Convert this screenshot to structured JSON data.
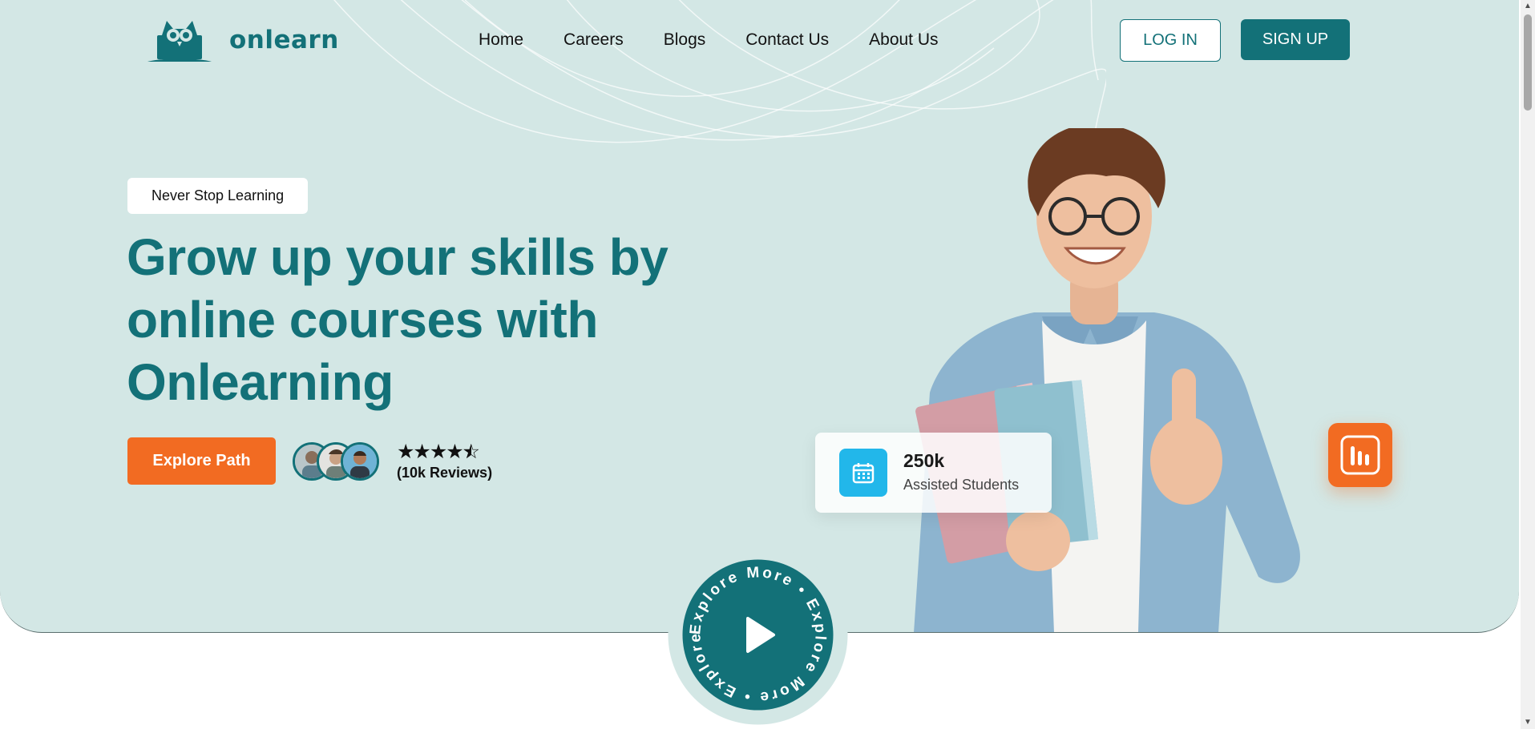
{
  "brand": {
    "name": "onlearn",
    "accent": "#137178",
    "orange": "#f26b22",
    "bg": "#d3e7e5"
  },
  "nav": [
    {
      "label": "Home"
    },
    {
      "label": "Careers"
    },
    {
      "label": "Blogs"
    },
    {
      "label": "Contact Us"
    },
    {
      "label": "About Us"
    }
  ],
  "auth": {
    "login_label": "LOG IN",
    "signup_label": "SIGN UP"
  },
  "hero": {
    "tag": "Never Stop Learning",
    "headline": "Grow up your skills by online courses with Onlearning",
    "cta_label": "Explore Path",
    "rating": {
      "stars": 4.5,
      "reviews": "(10k Reviews)"
    },
    "avatars": [
      "avatar-1",
      "avatar-2",
      "avatar-3"
    ]
  },
  "stat": {
    "value": "250k",
    "label": "Assisted Students",
    "icon": "calendar-icon"
  },
  "badge": {
    "icon": "bar-chart-icon"
  },
  "explore": {
    "ring_text": "Explore More • Explore More • Exploree • ",
    "icon": "play-icon"
  }
}
